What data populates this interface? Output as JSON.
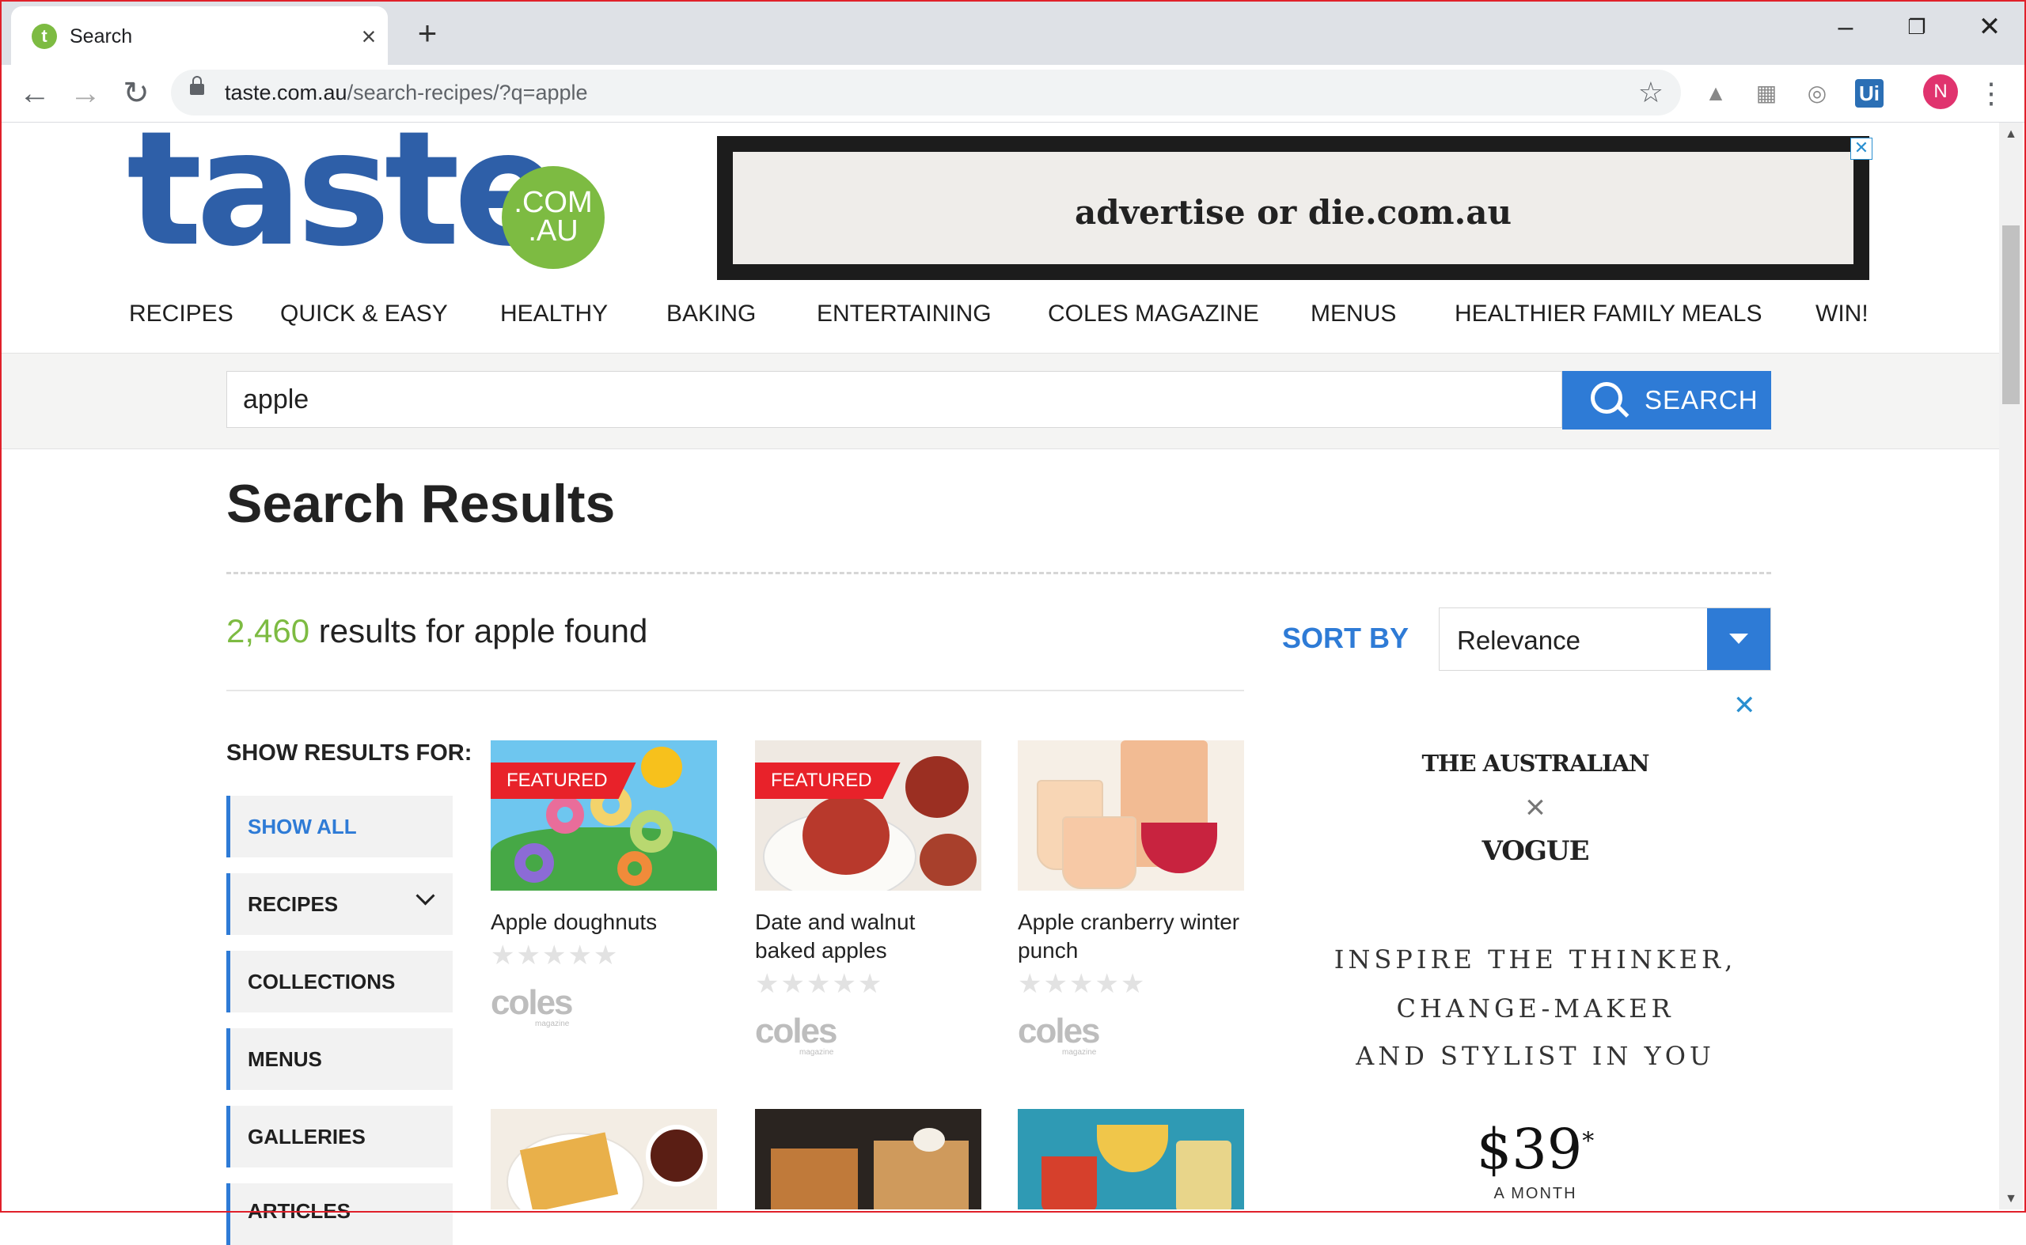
{
  "browser": {
    "tab_title": "Search",
    "tab_favicon_letter": "t",
    "url_domain": "taste.com.au",
    "url_path": "/search-recipes/?q=apple",
    "profile_initial": "N",
    "ext_ui_label": "Ui"
  },
  "site": {
    "logo_text": "taste",
    "logo_badge_line1": ".COM",
    "logo_badge_line2": ".AU",
    "ad_banner_text": "advertise or die.com.au",
    "nav": [
      "RECIPES",
      "QUICK & EASY",
      "HEALTHY",
      "BAKING",
      "ENTERTAINING",
      "COLES MAGAZINE",
      "MENUS",
      "HEALTHIER FAMILY MEALS",
      "WIN!"
    ]
  },
  "search": {
    "query": "apple",
    "button_label": "SEARCH"
  },
  "results": {
    "title": "Search Results",
    "count": "2,460",
    "count_suffix": "results for apple found",
    "sort_label": "SORT BY",
    "sort_value": "Relevance"
  },
  "filters": {
    "heading": "SHOW RESULTS FOR:",
    "items": [
      "SHOW ALL",
      "RECIPES",
      "COLLECTIONS",
      "MENUS",
      "GALLERIES",
      "ARTICLES"
    ]
  },
  "cards": [
    {
      "title": "Apple doughnuts",
      "badge": "FEATURED",
      "brand": "coles",
      "brand_sub": "magazine",
      "rating": 0
    },
    {
      "title": "Date and walnut baked apples",
      "badge": "FEATURED",
      "brand": "coles",
      "brand_sub": "magazine",
      "rating": 0
    },
    {
      "title": "Apple cranberry winter punch",
      "badge": "",
      "brand": "coles",
      "brand_sub": "magazine",
      "rating": 0
    }
  ],
  "side_ad": {
    "publisher1": "THE AUSTRALIAN",
    "publisher2": "VOGUE",
    "tag1": "INSPIRE THE THINKER,",
    "tag2": "CHANGE-MAKER",
    "tag3": "AND STYLIST IN YOU",
    "price": "$39",
    "price_note": "*",
    "period": "A MONTH"
  },
  "colors": {
    "brand_blue": "#2e5fa8",
    "accent_blue": "#2e7bd6",
    "brand_green": "#7dbb42",
    "featured_red": "#e8222a"
  }
}
